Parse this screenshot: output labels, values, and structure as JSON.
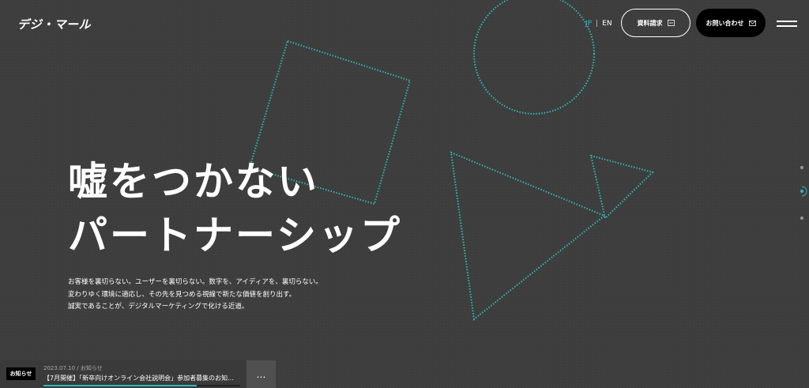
{
  "header": {
    "logo": "デジ・マール",
    "lang_jp": "JP",
    "lang_sep": "|",
    "lang_en": "EN",
    "docs_button": "資料請求",
    "contact_button": "お問い合わせ"
  },
  "hero": {
    "headline_line1": "嘘をつかない",
    "headline_line2": "パートナーシップ",
    "body_line1": "お客様を裏切らない。ユーザーを裏切らない。数字を、アイディアを、裏切らない。",
    "body_line2": "変わりゆく環境に適応し、その先を見つめる視線で新たな価値を創り出す。",
    "body_line3": "誠実であることが、デジタルマーケティングで化ける近道。"
  },
  "news": {
    "label": "お知らせ",
    "meta": "2023.07.10 / お知らせ",
    "title": "【7月開催】「新卒向けオンライン会社説明会」参加者募集のお知...",
    "more": "…",
    "progress": 0.78
  },
  "colors": {
    "accent": "#2fb8b8",
    "background": "#3d3d3d"
  }
}
